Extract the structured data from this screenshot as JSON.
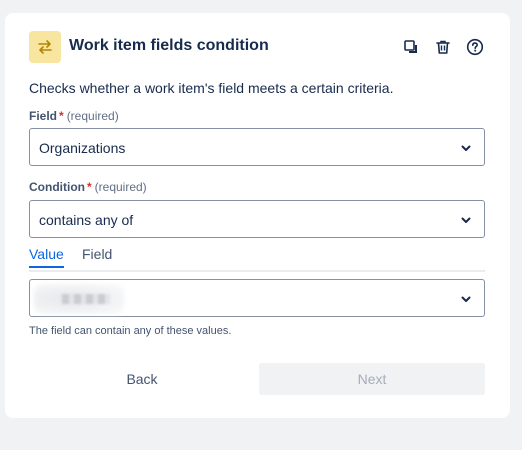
{
  "header": {
    "title": "Work item fields condition",
    "icons": {
      "rule": "swap-arrows-icon",
      "duplicate": "duplicate-icon",
      "delete": "trash-icon",
      "help": "help-icon"
    }
  },
  "description": "Checks whether a work item's field meets a certain criteria.",
  "field": {
    "label": "Field",
    "required_mark": "*",
    "required_note": "(required)",
    "value": "Organizations"
  },
  "condition": {
    "label": "Condition",
    "required_mark": "*",
    "required_note": "(required)",
    "value": "contains any of"
  },
  "tabs": [
    {
      "label": "Value",
      "active": true
    },
    {
      "label": "Field",
      "active": false
    }
  ],
  "value_select": {
    "value": ""
  },
  "helper_text": "The field can contain any of these values.",
  "buttons": {
    "back": "Back",
    "next": "Next"
  },
  "colors": {
    "accent": "#0c66e4",
    "required": "#c9372c",
    "rule_icon_bg": "#f8e6a0",
    "rule_icon_fg": "#b38600"
  }
}
